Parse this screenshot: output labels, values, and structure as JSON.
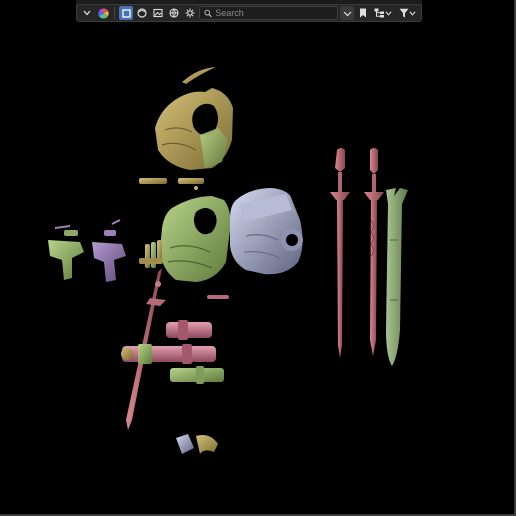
{
  "toolbar": {
    "search": {
      "placeholder": "Search",
      "value": ""
    },
    "icons": [
      "chevron-down-icon",
      "colour-wheel-icon",
      "box-filter-icon",
      "sphere-filter-icon",
      "image-filter-icon",
      "world-filter-icon",
      "gear-filter-icon",
      "search-icon",
      "sort-icon",
      "bookmark-icon",
      "hierarchy-icon",
      "chevron-down-icon",
      "funnel-icon",
      "chevron-down-icon"
    ]
  },
  "colors": {
    "active": "#4772b3",
    "gold": "#b09a55",
    "green": "#8fb064",
    "purple": "#8d73a8",
    "pink": "#c17090",
    "silver": "#9aa0be",
    "sword": "#b56a70"
  }
}
